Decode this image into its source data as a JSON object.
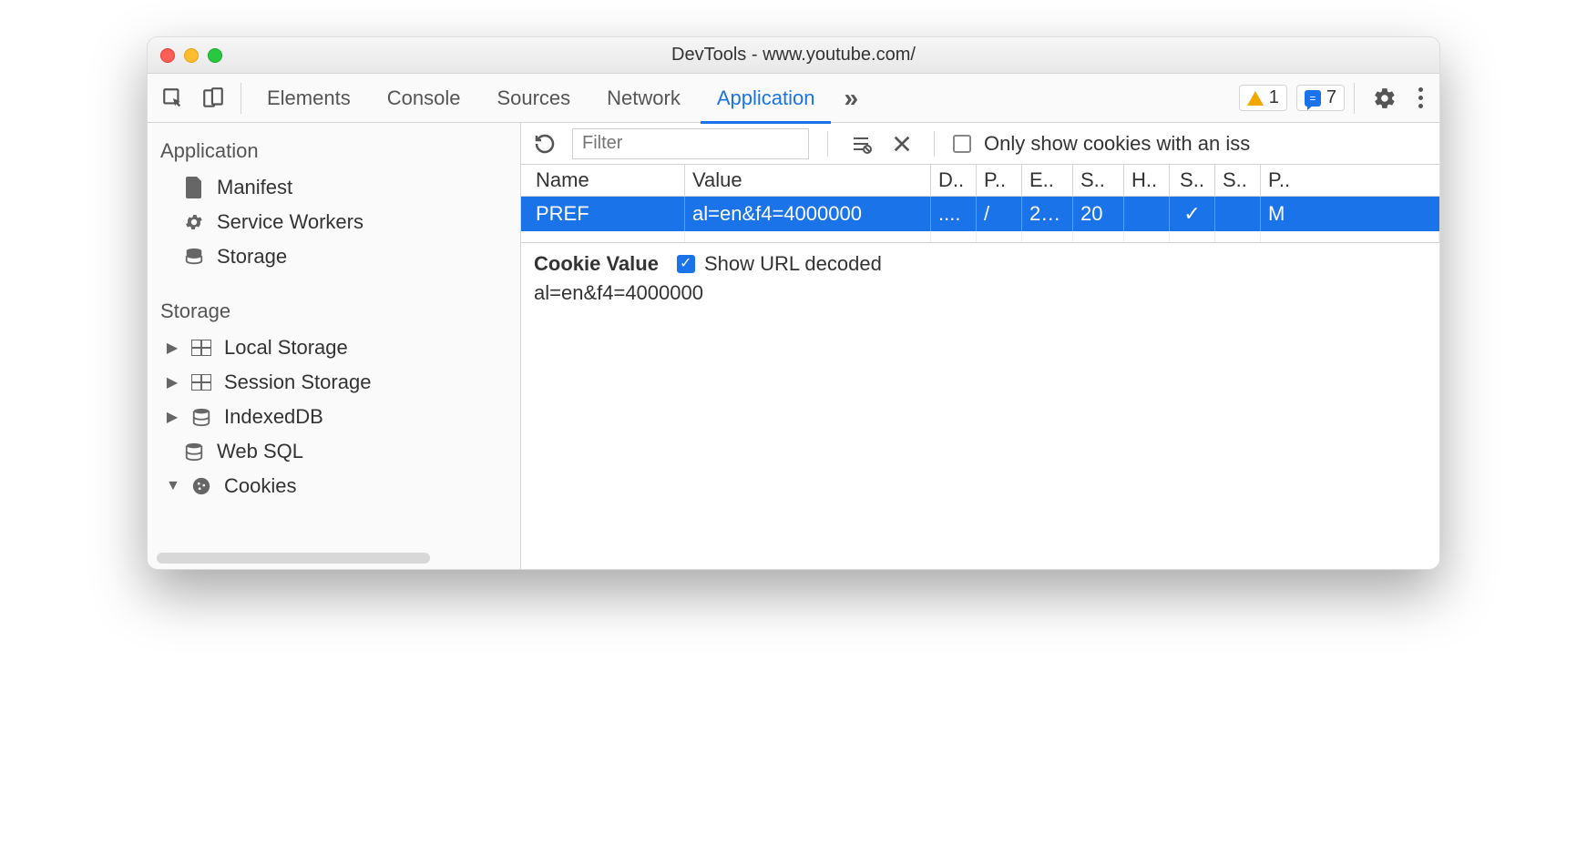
{
  "window": {
    "title": "DevTools - www.youtube.com/"
  },
  "tabs": {
    "elements": "Elements",
    "console": "Console",
    "sources": "Sources",
    "network": "Network",
    "application": "Application"
  },
  "badges": {
    "warnings": "1",
    "messages": "7"
  },
  "sidebar": {
    "heading_application": "Application",
    "items_app": {
      "manifest": "Manifest",
      "service_workers": "Service Workers",
      "storage": "Storage"
    },
    "heading_storage": "Storage",
    "items_storage": {
      "local_storage": "Local Storage",
      "session_storage": "Session Storage",
      "indexeddb": "IndexedDB",
      "web_sql": "Web SQL",
      "cookies": "Cookies"
    }
  },
  "toolbar": {
    "filter_placeholder": "Filter",
    "only_issue_label": "Only show cookies with an iss"
  },
  "table": {
    "headers": {
      "name": "Name",
      "value": "Value",
      "d": "D..",
      "p": "P..",
      "e": "E..",
      "s1": "S..",
      "h": "H..",
      "s2": "S..",
      "s3": "S..",
      "pr": "P.."
    },
    "rows": [
      {
        "name": "PREF",
        "value": "al=en&f4=4000000",
        "d": "....",
        "p": "/",
        "e": "2…",
        "s1": "20",
        "h": "",
        "s2": "✓",
        "s3": "",
        "pr": "M"
      }
    ]
  },
  "detail": {
    "title": "Cookie Value",
    "decoded_label": "Show URL decoded",
    "value": "al=en&f4=4000000"
  }
}
